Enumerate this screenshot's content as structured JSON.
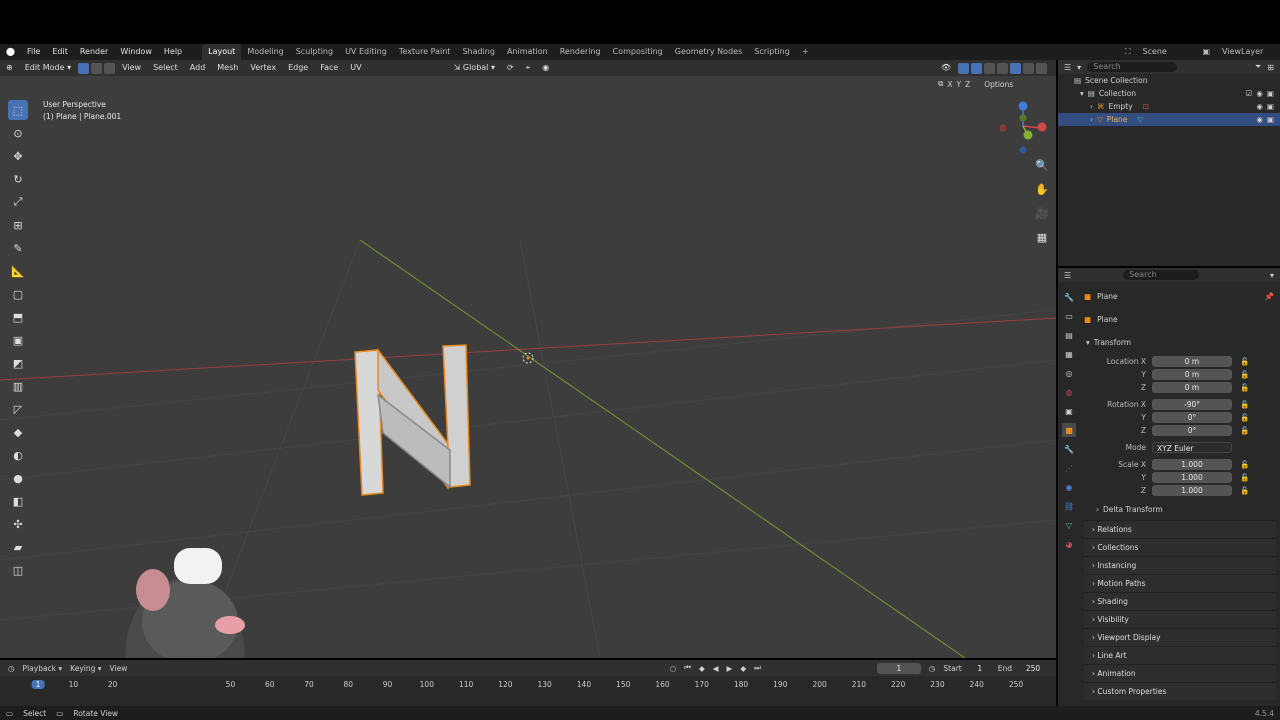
{
  "menus": [
    "File",
    "Edit",
    "Render",
    "Window",
    "Help"
  ],
  "workspaces": [
    "Layout",
    "Modeling",
    "Sculpting",
    "UV Editing",
    "Texture Paint",
    "Shading",
    "Animation",
    "Rendering",
    "Compositing",
    "Geometry Nodes",
    "Scripting"
  ],
  "active_workspace": "Layout",
  "scene": {
    "label": "Scene",
    "view_layer": "ViewLayer"
  },
  "viewport": {
    "mode": "Edit Mode",
    "menu": [
      "View",
      "Select",
      "Add",
      "Mesh",
      "Vertex",
      "Edge",
      "Face",
      "UV"
    ],
    "orientation": "Global",
    "perspective": "User Perspective",
    "object_info": "(1) Plane | Plane.001",
    "options": "Options",
    "axes": [
      "X",
      "Y",
      "Z"
    ]
  },
  "outliner": {
    "search_placeholder": "Search",
    "rows": [
      {
        "label": "Scene Collection",
        "indent": 0
      },
      {
        "label": "Collection",
        "indent": 1
      },
      {
        "label": "Empty",
        "indent": 2
      },
      {
        "label": "Plane",
        "indent": 2,
        "selected": true
      }
    ]
  },
  "properties": {
    "search_placeholder": "Search",
    "object_name": "Plane",
    "object_data_name": "Plane",
    "transform_label": "Transform",
    "location": {
      "label": "Location X",
      "x": "0 m",
      "y": "0 m",
      "z": "0 m"
    },
    "rotation": {
      "label": "Rotation X",
      "x": "-90°",
      "y": "0°",
      "z": "0°"
    },
    "mode": {
      "label": "Mode",
      "value": "XYZ Euler"
    },
    "scale": {
      "label": "Scale X",
      "x": "1.000",
      "y": "1.000",
      "z": "1.000"
    },
    "axis_y": "Y",
    "axis_z": "Z",
    "delta_transform": "Delta Transform",
    "panels": [
      "Relations",
      "Collections",
      "Instancing",
      "Motion Paths",
      "Shading",
      "Visibility",
      "Viewport Display",
      "Line Art",
      "Animation",
      "Custom Properties"
    ]
  },
  "timeline": {
    "playback": "Playback",
    "keying": "Keying",
    "view": "View",
    "current_frame": "1",
    "start_label": "Start",
    "start": "1",
    "end_label": "End",
    "end": "250",
    "ticks": [
      "1",
      "10",
      "20",
      "50",
      "60",
      "70",
      "80",
      "90",
      "100",
      "110",
      "120",
      "130",
      "140",
      "150",
      "160",
      "170",
      "180",
      "190",
      "200",
      "210",
      "220",
      "230",
      "240",
      "250"
    ]
  },
  "status": {
    "select": "Select",
    "rotate": "Rotate View",
    "version": "4.5.4"
  },
  "colors": {
    "accent": "#4772b3",
    "x_axis": "#d14a4a",
    "y_axis": "#8aae3a",
    "z_axis": "#3e7ed8",
    "selection": "#e8891c"
  }
}
